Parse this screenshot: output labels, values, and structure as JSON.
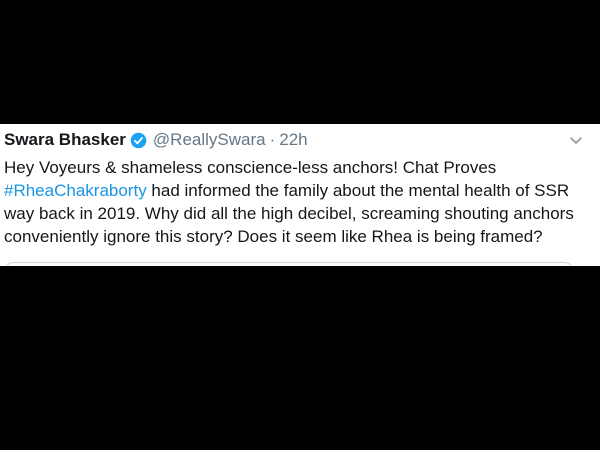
{
  "tweet": {
    "display_name": "Swara Bhasker",
    "handle": "@ReallySwara",
    "separator": "·",
    "time": "22h",
    "body_line1": "Hey Voyeurs & shameless conscience-less anchors! Chat Proves",
    "hashtag": "#RheaChakraborty",
    "body_line2_rest": " had informed the family about the mental health of SSR",
    "body_line3": "way back in 2019. Why did all the high decibel, screaming shouting anchors",
    "body_line4": "conveniently ignore this story? Does it seem like Rhea is being framed?"
  },
  "icons": {
    "verified": "verified-badge-icon",
    "menu": "chevron-down-icon"
  },
  "colors": {
    "background": "#000000",
    "card": "#ffffff",
    "text": "#14171a",
    "secondary": "#657786",
    "link": "#1b95e0",
    "verified": "#1da1f2"
  }
}
